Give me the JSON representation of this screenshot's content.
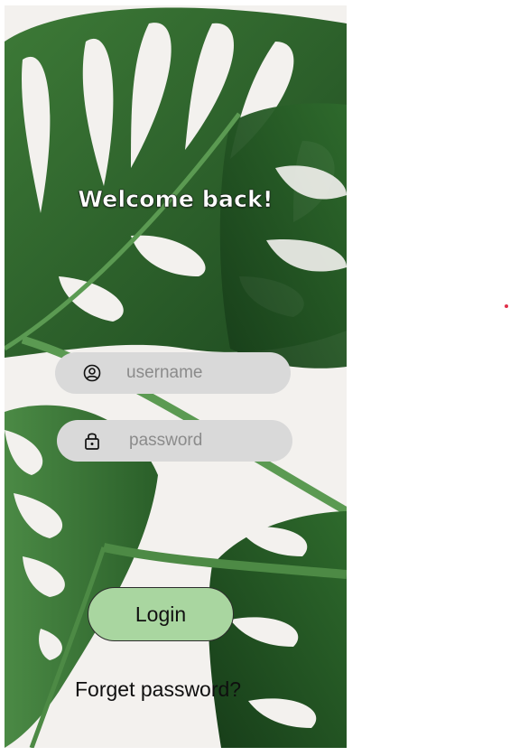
{
  "screen": {
    "title": "Welcome back!"
  },
  "form": {
    "username": {
      "placeholder": "username",
      "value": "",
      "icon": "user-circle-icon"
    },
    "password": {
      "placeholder": "password",
      "value": "",
      "icon": "lock-icon"
    },
    "login_label": "Login",
    "forget_label": "Forget password?"
  },
  "colors": {
    "field_background": "#d9d9d9",
    "login_button": "#a9d6a0",
    "background": "#f3f1ee",
    "leaf_dark": "#1f4a23",
    "leaf_mid": "#2f6b2e",
    "stray_dot": "#e0304a"
  }
}
